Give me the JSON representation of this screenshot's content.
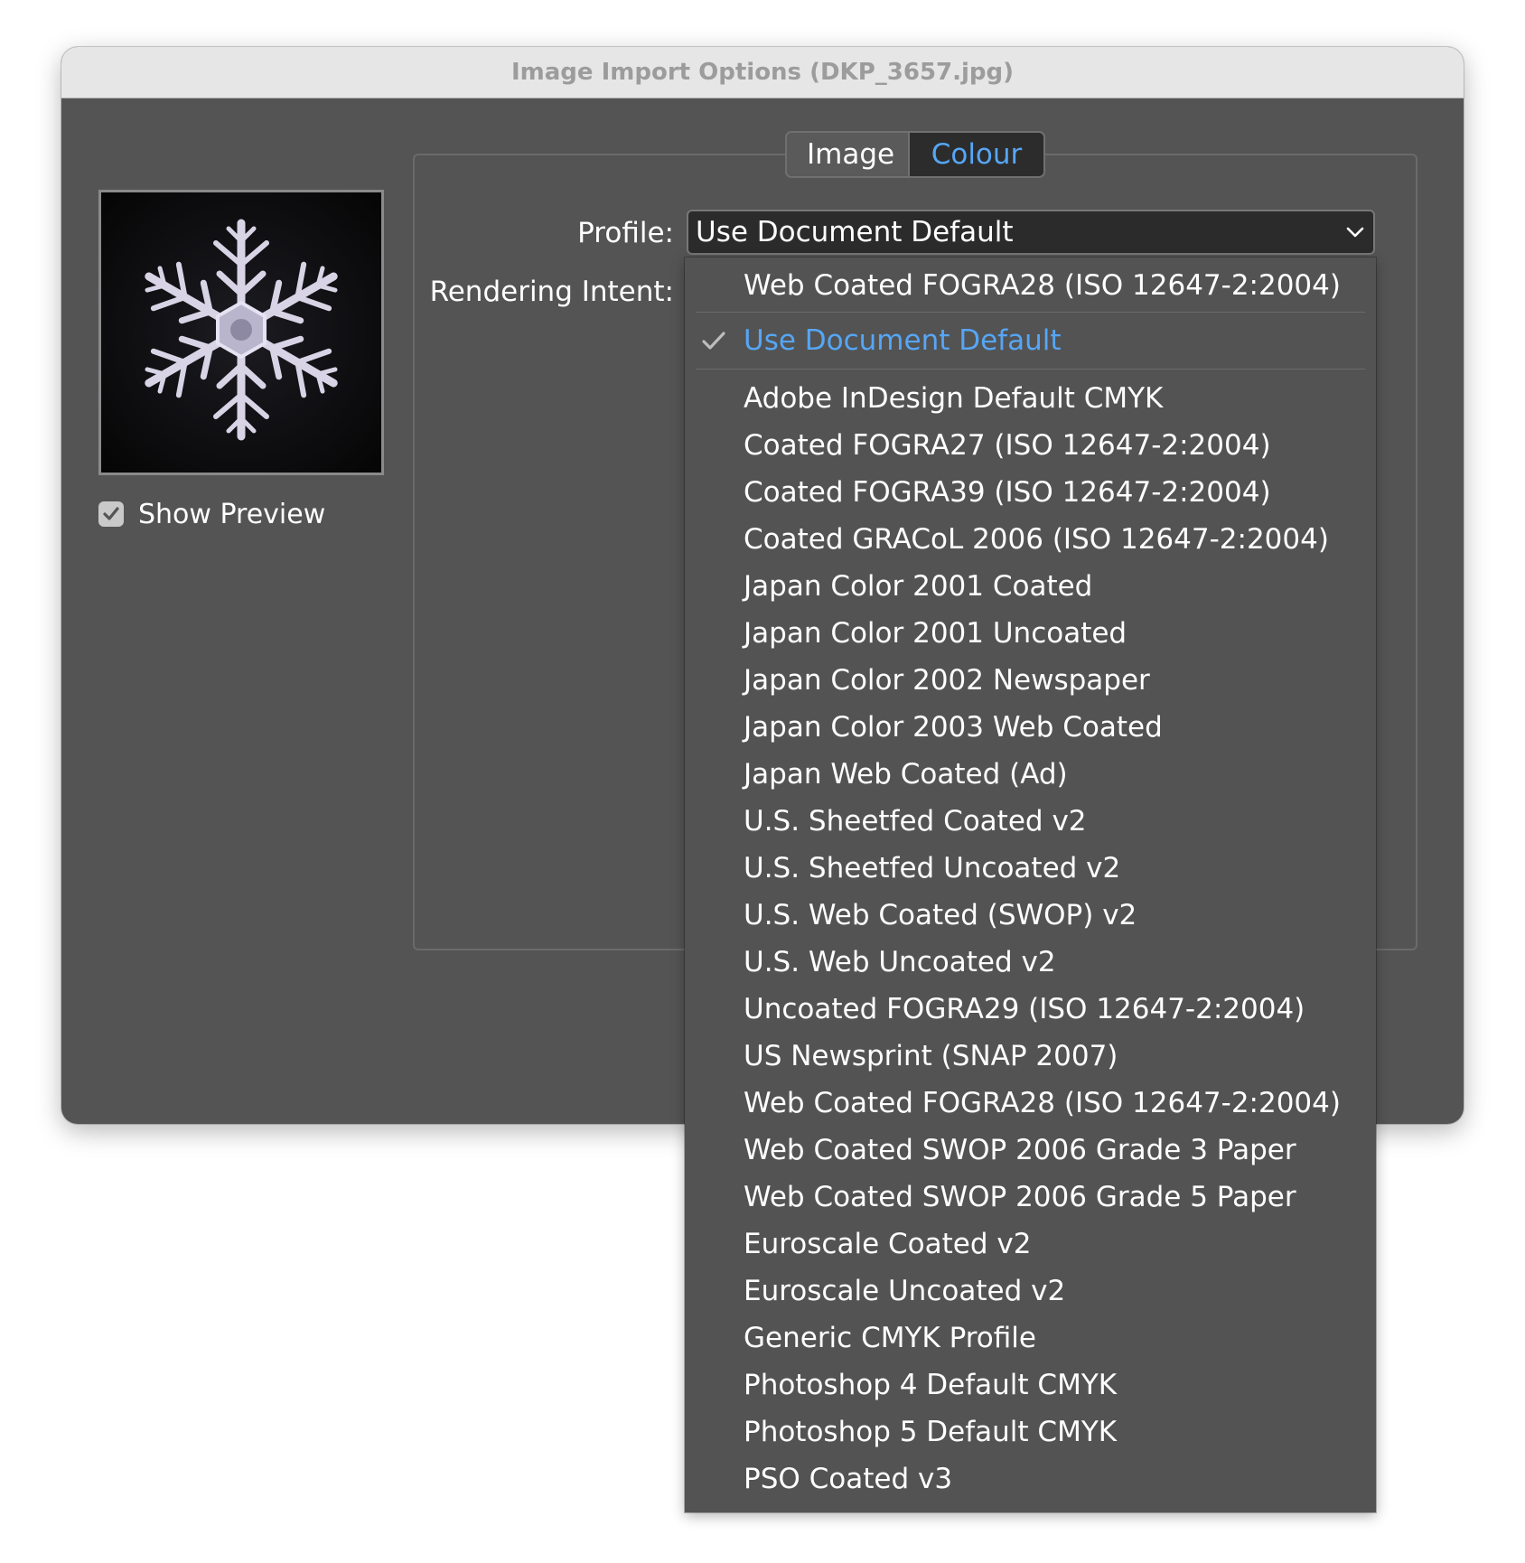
{
  "window": {
    "title": "Image Import Options (DKP_3657.jpg)"
  },
  "preview": {
    "image_name": "snowflake-preview",
    "show_preview_label": "Show Preview",
    "show_preview_checked": true
  },
  "tabs": [
    {
      "label": "Image",
      "active": false
    },
    {
      "label": "Colour",
      "active": true
    }
  ],
  "form": {
    "profile_label": "Profile:",
    "profile_value": "Use Document Default",
    "rendering_intent_label": "Rendering Intent:"
  },
  "dropdown": {
    "recent": "Web Coated FOGRA28 (ISO 12647-2:2004)",
    "selected": "Use Document Default",
    "items": [
      "Adobe InDesign Default CMYK",
      "Coated FOGRA27 (ISO 12647-2:2004)",
      "Coated FOGRA39 (ISO 12647-2:2004)",
      "Coated GRACoL 2006 (ISO 12647-2:2004)",
      "Japan Color 2001 Coated",
      "Japan Color 2001 Uncoated",
      "Japan Color 2002 Newspaper",
      "Japan Color 2003 Web Coated",
      "Japan Web Coated (Ad)",
      "U.S. Sheetfed Coated v2",
      "U.S. Sheetfed Uncoated v2",
      "U.S. Web Coated (SWOP) v2",
      "U.S. Web Uncoated v2",
      "Uncoated FOGRA29 (ISO 12647-2:2004)",
      "US Newsprint (SNAP 2007)",
      "Web Coated FOGRA28 (ISO 12647-2:2004)",
      "Web Coated SWOP 2006 Grade 3 Paper",
      "Web Coated SWOP 2006 Grade 5 Paper",
      "Euroscale Coated v2",
      "Euroscale Uncoated v2",
      "Generic CMYK Profile",
      "Photoshop 4 Default CMYK",
      "Photoshop 5 Default CMYK",
      "PSO Coated v3"
    ]
  },
  "colors": {
    "dialog_bg": "#545454",
    "titlebar_bg": "#e6e6e6",
    "accent": "#56a6f5",
    "menu_bg": "#535353"
  },
  "icons": {
    "checkbox": "checkmark-icon",
    "dropdown": "chevron-down-icon",
    "selected": "checkmark-icon"
  }
}
